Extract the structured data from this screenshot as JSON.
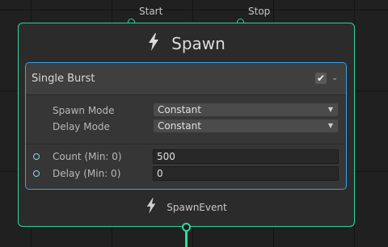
{
  "flow_inputs": {
    "start_label": "Start",
    "stop_label": "Stop"
  },
  "context": {
    "title": "Spawn",
    "icon": "lightning-bolt-icon",
    "event_label": "SpawnEvent",
    "event_icon": "lightning-bolt-icon",
    "accent_color": "#2ed49a"
  },
  "block": {
    "title": "Single Burst",
    "enabled": true,
    "checkmark": "✔",
    "chevron": "⌄",
    "border_color": "#3b9ee8",
    "settings": [
      {
        "label": "Spawn Mode",
        "value": "Constant"
      },
      {
        "label": "Delay Mode",
        "value": "Constant"
      }
    ],
    "properties": [
      {
        "label": "Count (Min: 0)",
        "value": "500"
      },
      {
        "label": "Delay (Min: 0)",
        "value": "0"
      }
    ]
  }
}
